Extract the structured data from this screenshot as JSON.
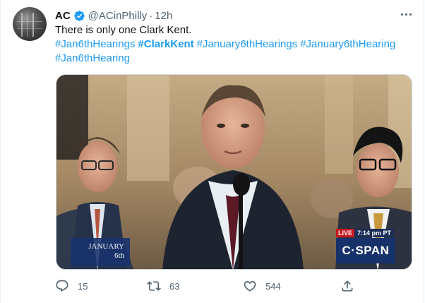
{
  "author": {
    "name": "AC",
    "handle": "@ACinPhilly",
    "separator": "·",
    "time": "12h"
  },
  "tweet": {
    "text": "There is only one Clark Kent.",
    "hashtags_line1": [
      {
        "text": "#Jan6thHearings",
        "bold": false
      },
      {
        "text": "#ClarkKent",
        "bold": true
      },
      {
        "text": "#January6thHearings",
        "bold": false
      },
      {
        "text": "#January6thHearing",
        "bold": false
      }
    ],
    "hashtags_line2": [
      {
        "text": "#Jan6thHearing",
        "bold": false
      }
    ]
  },
  "media": {
    "live_label": "LIVE",
    "time_label": "7:14 pm PT",
    "network_label": "C·SPAN",
    "date_month": "JANUARY",
    "date_day": "6th"
  },
  "actions": {
    "reply_count": "15",
    "retweet_count": "63",
    "like_count": "544"
  },
  "colors": {
    "accent": "#1d9bf0",
    "muted": "#536471",
    "text": "#0f1419"
  },
  "icons": [
    "verified-icon",
    "more-icon",
    "reply-icon",
    "retweet-icon",
    "like-icon",
    "share-icon"
  ]
}
